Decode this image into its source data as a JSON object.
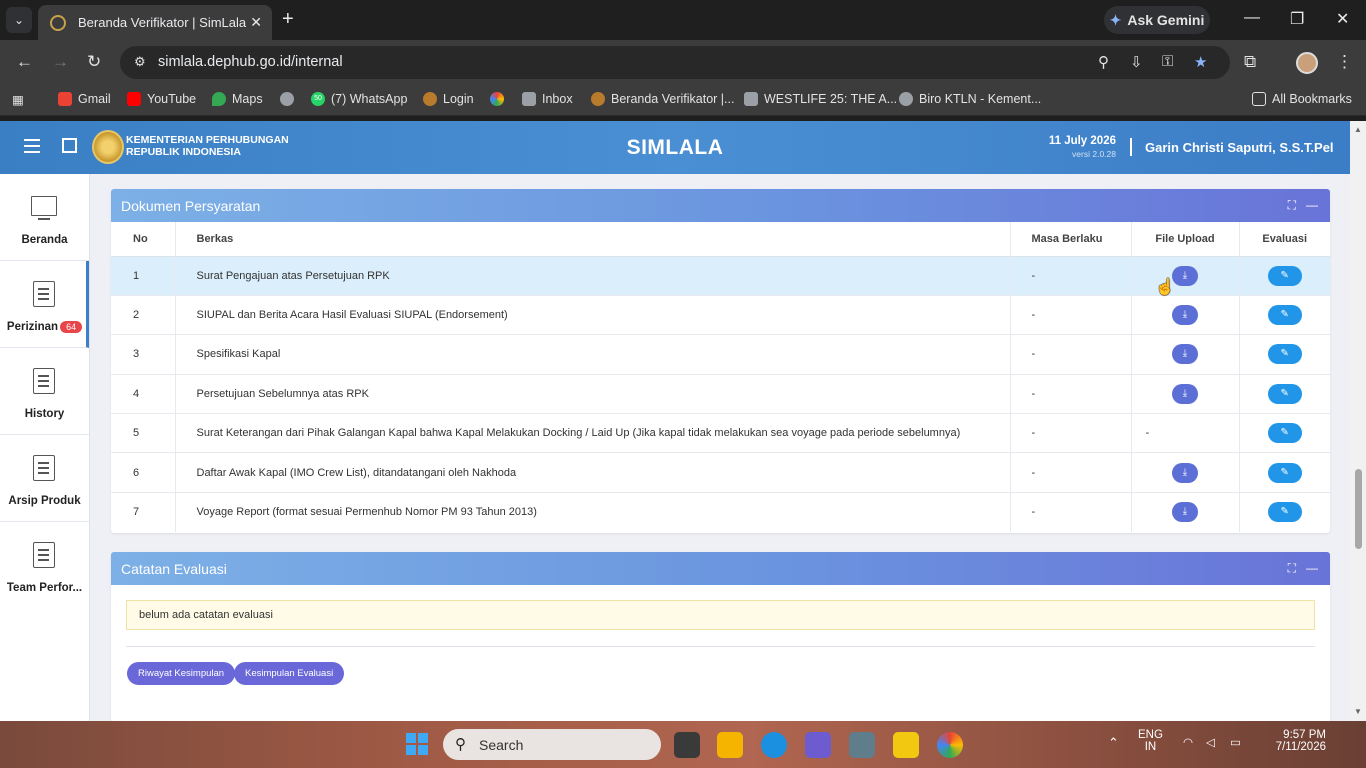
{
  "browser": {
    "tab_title": "Beranda Verifikator | SimLala",
    "url": "simlala.dephub.go.id/internal",
    "ask_gemini": "Ask Gemini",
    "bookmarks": [
      {
        "label": "Gmail",
        "color": "#ea4335"
      },
      {
        "label": "YouTube",
        "color": "#ff0000"
      },
      {
        "label": "Maps",
        "color": "#34a853"
      },
      {
        "label": "",
        "color": "#9aa0a6"
      },
      {
        "label": "(7) WhatsApp",
        "color": "#25d366",
        "count": "50"
      },
      {
        "label": "Login",
        "color": "#b87a2b"
      },
      {
        "label": "",
        "color": "#fbbc04"
      },
      {
        "label": "Inbox",
        "color": "#9aa0a6"
      },
      {
        "label": "Beranda Verifikator |...",
        "color": "#b87a2b"
      },
      {
        "label": "WESTLIFE 25: THE A...",
        "color": "#9aa0a6"
      },
      {
        "label": "Biro KTLN - Kement...",
        "color": "#9aa0a6"
      }
    ],
    "all_bookmarks": "All Bookmarks"
  },
  "app": {
    "org_line1": "KEMENTERIAN PERHUBUNGAN",
    "org_line2": "REPUBLIK INDONESIA",
    "title": "SIMLALA",
    "date": "11 July 2026",
    "version": "versi 2.0.28",
    "user": "Garin Christi Saputri, S.S.T.Pel"
  },
  "sidebar": {
    "items": [
      {
        "label": "Beranda"
      },
      {
        "label": "Perizinan",
        "badge": "64"
      },
      {
        "label": "History"
      },
      {
        "label": "Arsip Produk"
      },
      {
        "label": "Team Perfor..."
      }
    ]
  },
  "dokumen": {
    "title": "Dokumen Persyaratan",
    "columns": [
      "No",
      "Berkas",
      "Masa Berlaku",
      "File Upload",
      "Evaluasi"
    ],
    "rows": [
      {
        "no": "1",
        "berkas": "Surat Pengajuan atas Persetujuan RPK",
        "masa": "-",
        "upload": true
      },
      {
        "no": "2",
        "berkas": "SIUPAL dan Berita Acara Hasil Evaluasi SIUPAL (Endorsement)",
        "masa": "-",
        "upload": true
      },
      {
        "no": "3",
        "berkas": "Spesifikasi Kapal",
        "masa": "-",
        "upload": true
      },
      {
        "no": "4",
        "berkas": "Persetujuan Sebelumnya atas RPK",
        "masa": "-",
        "upload": true
      },
      {
        "no": "5",
        "berkas": "Surat Keterangan dari Pihak Galangan Kapal bahwa Kapal Melakukan Docking / Laid Up (Jika kapal tidak melakukan sea voyage pada periode sebelumnya)",
        "masa": "-",
        "upload": false,
        "upload_text": "-"
      },
      {
        "no": "6",
        "berkas": "Daftar Awak Kapal (IMO Crew List), ditandatangani oleh Nakhoda",
        "masa": "-",
        "upload": true
      },
      {
        "no": "7",
        "berkas": "Voyage Report (format sesuai Permenhub Nomor PM 93 Tahun 2013)",
        "masa": "-",
        "upload": true
      }
    ]
  },
  "catatan": {
    "title": "Catatan Evaluasi",
    "empty_text": "belum ada catatan evaluasi",
    "btn_riwayat": "Riwayat Kesimpulan",
    "btn_kesimpulan": "Kesimpulan Evaluasi"
  },
  "taskbar": {
    "search": "Search",
    "lang1": "ENG",
    "lang2": "IN",
    "time": "9:57 PM",
    "date": "7/11/2026"
  }
}
